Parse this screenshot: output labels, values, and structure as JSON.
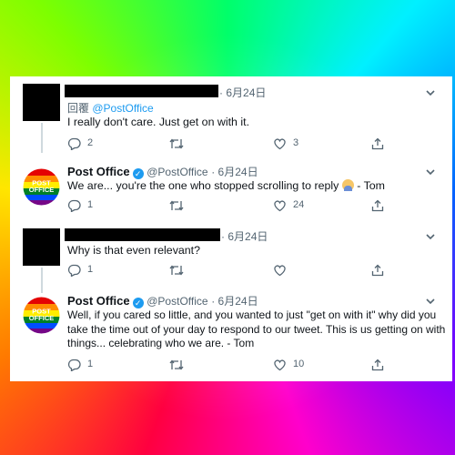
{
  "tweets": [
    {
      "author_name": "",
      "handle": "",
      "date": "6月24日",
      "reply_prefix": "回覆",
      "reply_mention": "@PostOffice",
      "text": "I really don't care. Just get on with it.",
      "replies": "2",
      "retweets": "",
      "likes": "3"
    },
    {
      "author_name": "Post Office",
      "handle": "@PostOffice",
      "date": "6月24日",
      "text": "We are... you're the one who stopped scrolling to reply",
      "text_suffix": "- Tom",
      "replies": "1",
      "retweets": "",
      "likes": "24"
    },
    {
      "author_name": "",
      "handle": "",
      "date": "6月24日",
      "text": "Why is that even relevant?",
      "replies": "1",
      "retweets": "",
      "likes": ""
    },
    {
      "author_name": "Post Office",
      "handle": "@PostOffice",
      "date": "6月24日",
      "text": "Well, if you cared so little, and you wanted to just \"get on with it\" why did you take the time out of your day to respond to our tweet. This is us getting on with things... celebrating who we are. - Tom",
      "replies": "1",
      "retweets": "",
      "likes": "10"
    }
  ],
  "logo": {
    "line1": "POST",
    "line2": "OFFICE"
  },
  "colors": {
    "accent": "#1d9bf0",
    "muted": "#536471",
    "text": "#0f1419"
  },
  "icons": [
    "reply-icon",
    "retweet-icon",
    "like-icon",
    "share-icon",
    "chevron-down-icon",
    "verified-badge-icon"
  ]
}
